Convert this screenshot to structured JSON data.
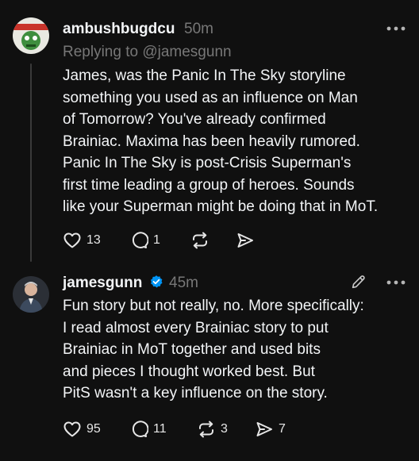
{
  "posts": [
    {
      "username": "ambushbugdcu",
      "time": "50m",
      "reply_to": "Replying to @jamesgunn",
      "lines": [
        "James, was the Panic In The Sky storyline",
        "something you used as an influence on Man",
        "of Tomorrow? You've already confirmed",
        "Brainiac. Maxima has been heavily rumored.",
        "Panic In The Sky is post-Crisis Superman's",
        "first time leading a group of heroes. Sounds",
        "like your Superman might be doing that in MoT."
      ],
      "likes": "13",
      "replies": "1",
      "reposts": "",
      "shares": ""
    },
    {
      "username": "jamesgunn",
      "time": "45m",
      "verified": true,
      "lines": [
        "Fun story but not really, no. More specifically:",
        "I read almost every Brainiac story to put",
        "Brainiac in MoT together and used bits",
        "and pieces I thought worked best. But",
        "PitS wasn't a key influence on the story."
      ],
      "likes": "95",
      "replies": "11",
      "reposts": "3",
      "shares": "7"
    }
  ],
  "colors": {
    "background": "#101010",
    "text": "#f3f5f7",
    "muted": "#777777",
    "verified": "#0095f6"
  }
}
